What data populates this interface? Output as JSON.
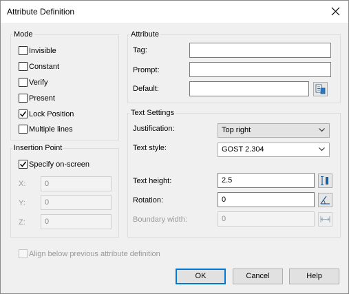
{
  "window": {
    "title": "Attribute Definition"
  },
  "mode": {
    "legend": "Mode",
    "options": [
      {
        "label": "Invisible",
        "checked": false
      },
      {
        "label": "Constant",
        "checked": false
      },
      {
        "label": "Verify",
        "checked": false
      },
      {
        "label": "Present",
        "checked": false
      },
      {
        "label": "Lock Position",
        "checked": true
      },
      {
        "label": "Multiple lines",
        "checked": false
      }
    ]
  },
  "insertion_point": {
    "legend": "Insertion Point",
    "specify_on_screen": {
      "label": "Specify on-screen",
      "checked": true
    },
    "x": {
      "label": "X:",
      "value": "0"
    },
    "y": {
      "label": "Y:",
      "value": "0"
    },
    "z": {
      "label": "Z:",
      "value": "0"
    }
  },
  "attribute": {
    "legend": "Attribute",
    "tag": {
      "label": "Tag:",
      "value": ""
    },
    "prompt": {
      "label": "Prompt:",
      "value": ""
    },
    "default": {
      "label": "Default:",
      "value": "",
      "button_icon": "insert-field-icon"
    }
  },
  "text_settings": {
    "legend": "Text Settings",
    "justification": {
      "label": "Justification:",
      "value": "Top right"
    },
    "text_style": {
      "label": "Text style:",
      "value": "GOST 2.304"
    },
    "text_height": {
      "label": "Text height:",
      "value": "2.5",
      "button_icon": "pick-height-icon"
    },
    "rotation": {
      "label": "Rotation:",
      "value": "0",
      "button_icon": "pick-rotation-icon"
    },
    "boundary_width": {
      "label": "Boundary width:",
      "value": "0",
      "button_icon": "pick-width-icon"
    }
  },
  "align_below": {
    "label": "Align below previous attribute definition",
    "checked": false,
    "enabled": false
  },
  "buttons": {
    "ok": "OK",
    "cancel": "Cancel",
    "help": "Help"
  },
  "colors": {
    "accent": "#0078d7",
    "dialog_bg": "#f0f0f0"
  }
}
